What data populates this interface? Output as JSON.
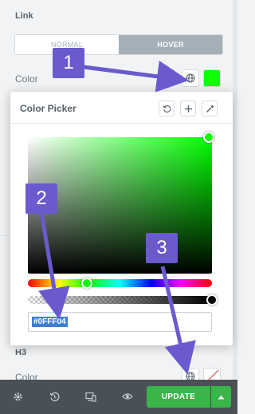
{
  "panel": {
    "link_section_title": "Link",
    "tabs": [
      {
        "label": "NORMAL"
      },
      {
        "label": "HOVER"
      }
    ],
    "color_label": "Color",
    "h3_section_title": "H3",
    "h3_color_label": "Color"
  },
  "picker": {
    "title": "Color Picker",
    "hex_value": "#0FFF04",
    "selected_color": "#0fff04"
  },
  "footer": {
    "update_label": "UPDATE"
  },
  "annotations": {
    "badge_1": "1",
    "badge_2": "2",
    "badge_3": "3",
    "color": "#6a5acd"
  },
  "colors": {
    "accent_green": "#39b54a",
    "panel_bg": "#f1f3f5",
    "footer_bg": "#495157"
  }
}
